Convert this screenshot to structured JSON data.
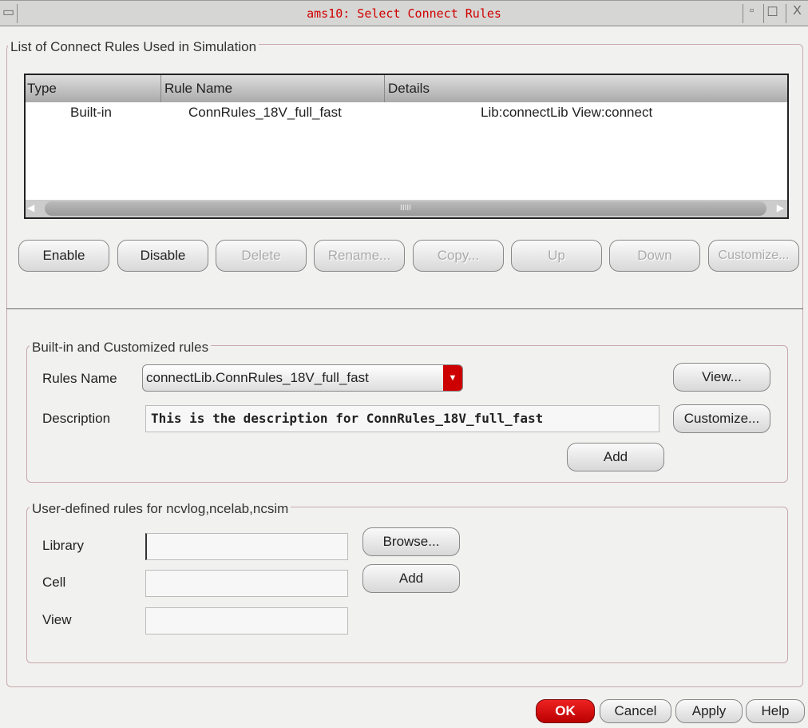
{
  "window": {
    "title": "ams10: Select Connect Rules",
    "minimize": "▫",
    "maximize": "☐",
    "close": "X",
    "menu": "▭"
  },
  "list_section": {
    "label": "List of Connect Rules Used in Simulation",
    "columns": [
      "Type",
      "Rule Name",
      "Details"
    ],
    "rows": [
      {
        "type": "Built-in",
        "rule_name": "ConnRules_18V_full_fast",
        "details": "Lib:connectLib View:connect"
      }
    ],
    "scroll_grip": "IIIII",
    "buttons": [
      {
        "label": "Enable",
        "enabled": true
      },
      {
        "label": "Disable",
        "enabled": true
      },
      {
        "label": "Delete",
        "enabled": false
      },
      {
        "label": "Rename...",
        "enabled": false
      },
      {
        "label": "Copy...",
        "enabled": false
      },
      {
        "label": "Up",
        "enabled": false
      },
      {
        "label": "Down",
        "enabled": false
      },
      {
        "label": "Customize...",
        "enabled": false
      }
    ]
  },
  "builtin_section": {
    "label": "Built-in and Customized rules",
    "rules_name_label": "Rules Name",
    "rules_name_value": "connectLib.ConnRules_18V_full_fast",
    "description_label": "Description",
    "description_value": "This is the description for ConnRules_18V_full_fast",
    "view_button": "View...",
    "customize_button": "Customize...",
    "add_button": "Add"
  },
  "user_section": {
    "label": "User-defined rules for ncvlog,ncelab,ncsim",
    "library_label": "Library",
    "library_value": "",
    "cell_label": "Cell",
    "cell_value": "",
    "view_label": "View",
    "view_value": "",
    "browse_button": "Browse...",
    "add_button": "Add"
  },
  "footer": {
    "ok": "OK",
    "cancel": "Cancel",
    "apply": "Apply",
    "help": "Help"
  }
}
